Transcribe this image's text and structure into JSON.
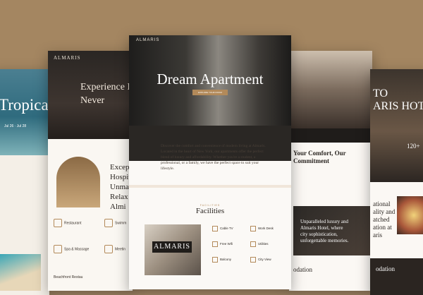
{
  "cards": {
    "left": {
      "hero_title": "Tropica",
      "dates": "Jul 26 · Jul 28"
    },
    "two": {
      "brand": "ALMARIS",
      "hero_title": "Experience H\nNever",
      "title": "Excep\nHospita\nUnma\nRelax\nAlmi",
      "services": [
        {
          "label": "Restaurant"
        },
        {
          "label": "Swimm"
        },
        {
          "label": "Spa & Massage"
        },
        {
          "label": "Meetin"
        }
      ],
      "footer": "Beachfront Restau"
    },
    "main": {
      "brand": "ALMARIS",
      "hero_title": "Dream Apartment",
      "cta": "EXPLORE YOUR ROOM",
      "intro": "Discover the comfort and convenience of modern living at Almaris. Located in the heart of New York, our apartments offer the perfect blend of luxury and affordability. Whether you're a student, a professional, or a family, we have the perfect space to suit your lifestyle.",
      "facilities_label": "FACILITIES",
      "facilities_title": "Facilities",
      "logo": "ALMARIS",
      "facilities": [
        {
          "label": "Cable TV"
        },
        {
          "label": "Work Desk"
        },
        {
          "label": "Free Wifi"
        },
        {
          "label": "Utilities"
        },
        {
          "label": "Balcony"
        },
        {
          "label": "City View"
        }
      ]
    },
    "right": {
      "heading": "Your Comfort, Our\nCommitment",
      "feature": "Unparalleled luxury and\nAlmaris Hotel, where\ncity sophistication,\nunforgettable memories.",
      "footer": "odation"
    },
    "far": {
      "hero_title": "TO\nARIS HOTEL",
      "badge": "120+",
      "body": "ational\nality and\natched\nation at\naris",
      "footer": "odation"
    }
  }
}
